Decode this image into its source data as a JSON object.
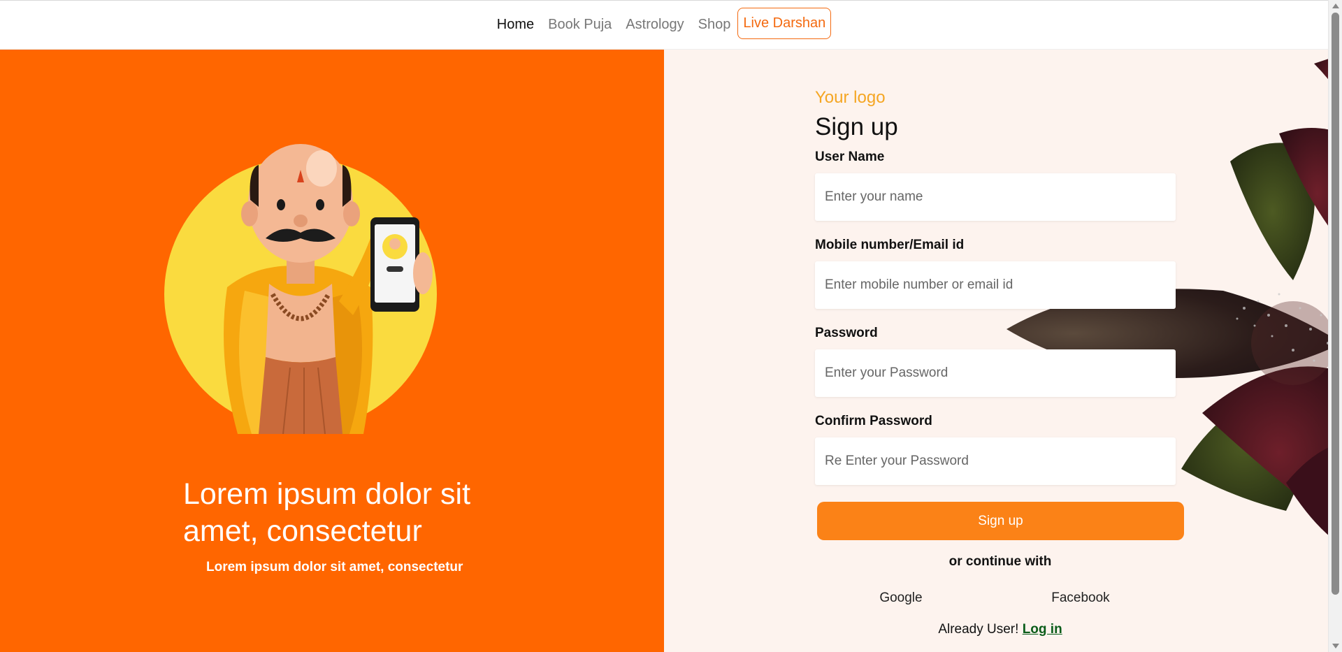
{
  "nav": {
    "home": "Home",
    "book_puja": "Book Puja",
    "astrology": "Astrology",
    "shop": "Shop",
    "live_darshan": "Live Darshan"
  },
  "hero": {
    "title": "Lorem ipsum dolor sit amet, consectetur",
    "subtitle": "Lorem ipsum dolor sit amet, consectetur"
  },
  "form": {
    "logo": "Your logo",
    "title": "Sign up",
    "fields": [
      {
        "label": "User Name",
        "placeholder": "Enter your name",
        "value": ""
      },
      {
        "label": "Mobile number/Email id",
        "placeholder": "Enter mobile number or email id",
        "value": ""
      },
      {
        "label": "Password",
        "placeholder": "Enter your Password",
        "value": ""
      },
      {
        "label": "Confirm Password",
        "placeholder": "Re Enter your Password",
        "value": ""
      }
    ],
    "submit_label": "Sign up",
    "or_continue": "or continue with",
    "google": "Google",
    "facebook": "Facebook",
    "already_user": "Already User!",
    "login_link": "Log in"
  },
  "colors": {
    "brand_orange": "#ff6600",
    "button_orange": "#fb8217",
    "logo_yellow": "#f5a623",
    "panel_bg": "#fdf3ee",
    "login_green": "#0a5c19"
  }
}
